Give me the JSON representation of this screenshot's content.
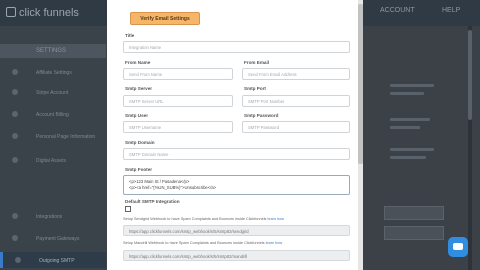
{
  "app": {
    "logo_text": "click funnels",
    "account_label": "ACCOUNT",
    "help_label": "HELP"
  },
  "sidebar": {
    "header": "SETTINGS",
    "items": [
      {
        "label": "Affiliate Settings"
      },
      {
        "label": "Stripe Account"
      },
      {
        "label": "Account Billing"
      },
      {
        "label": "Personal Page Information"
      },
      {
        "label": "Digital Assets"
      },
      {
        "label": ""
      },
      {
        "label": ""
      },
      {
        "label": "Integrations"
      },
      {
        "label": "Payment Gateways"
      },
      {
        "label": "Outgoing SMTP"
      }
    ]
  },
  "modal": {
    "verify_button": "Verify Email Settings",
    "fields": {
      "title": {
        "label": "Title",
        "placeholder": "Integration Name"
      },
      "from_name": {
        "label": "From Name",
        "placeholder": "Send From Name"
      },
      "from_email": {
        "label": "From Email",
        "placeholder": "Send From Email Address"
      },
      "smtp_server": {
        "label": "Smtp Server",
        "placeholder": "SMTP Server URL"
      },
      "smtp_port": {
        "label": "Smtp Port",
        "placeholder": "SMTP Port Number"
      },
      "smtp_user": {
        "label": "Smtp User",
        "placeholder": "SMTP Username"
      },
      "smtp_password": {
        "label": "Smtp Password",
        "placeholder": "SMTP Password"
      },
      "smtp_domain": {
        "label": "Smtp Domain",
        "placeholder": "SMTP Domain Name"
      },
      "smtp_footer": {
        "label": "Smtp Footer",
        "line1": "<p>123 Main St / Pasadena</p>",
        "line2": "<p><a href=\"{%UN_SUB%}\">Unsubscribe</a>"
      }
    },
    "default_smtp": {
      "label": "Default SMTP Integration",
      "checked": false
    },
    "sendgrid": {
      "text": "Setup Sendgrid Webhook to have Spam Complaints and Bounces inside Clickfunnels",
      "link": "learn how",
      "url": "https://app.clickfunnels.com/smtp_webhook/s/5/smtp82/sendgrid"
    },
    "mandrill": {
      "text": "Setup Mandrill Webhook to have Spam Complaints and Bounces inside Clickfunnels",
      "link": "learn how",
      "url": "https://app.clickfunnels.com/smtp_webhook/s/5/smtp82/mandrill"
    }
  },
  "colors": {
    "accent_orange": "#f5b66a",
    "chat_blue": "#2f8ee2"
  }
}
